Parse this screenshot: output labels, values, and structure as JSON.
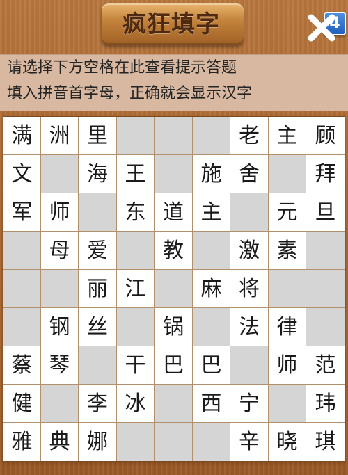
{
  "header": {
    "title": "疯狂填字",
    "level": "4",
    "close_icon": "close-icon"
  },
  "hint": {
    "line1": "请选择下方空格在此查看提示答题",
    "line2": "填入拼音首字母，正确就会显示汉字"
  },
  "grid": {
    "rows": [
      [
        "满",
        "洲",
        "里",
        "",
        "",
        "",
        "老",
        "主",
        "顾"
      ],
      [
        "文",
        "",
        "海",
        "王",
        "",
        "施",
        "舍",
        "",
        "拜"
      ],
      [
        "军",
        "师",
        "",
        "东",
        "道",
        "主",
        "",
        "元",
        "旦"
      ],
      [
        "",
        "母",
        "爱",
        "",
        "教",
        "",
        "激",
        "素",
        ""
      ],
      [
        "",
        "",
        "丽",
        "江",
        "",
        "麻",
        "将",
        "",
        ""
      ],
      [
        "",
        "钢",
        "丝",
        "",
        "锅",
        "",
        "法",
        "律",
        ""
      ],
      [
        "蔡",
        "琴",
        "",
        "干",
        "巴",
        "巴",
        "",
        "师",
        "范"
      ],
      [
        "健",
        "",
        "李",
        "冰",
        "",
        "西",
        "宁",
        "",
        "玮"
      ],
      [
        "雅",
        "典",
        "娜",
        "",
        "",
        "",
        "辛",
        "晓",
        "琪"
      ]
    ]
  },
  "colors": {
    "wood_background": "#a8662f",
    "hint_background": "#d8b8a0",
    "empty_cell": "#d5d5d5",
    "filled_cell": "#ffffff",
    "level_badge": "#2e6fd0"
  }
}
